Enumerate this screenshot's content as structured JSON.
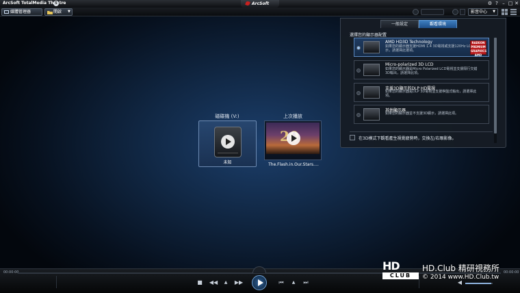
{
  "titlebar": {
    "app_title": "ArcSoft TotalMedia Theatre",
    "badge": "5",
    "brand": "ArcSoft"
  },
  "toolbar": {
    "breadcrumb_home": "媒體管理器",
    "breadcrumb_open": "開啟",
    "media_center": "影音中心"
  },
  "tiles": {
    "disc": {
      "label": "磁碟機 (V:)",
      "caption": "未知"
    },
    "last_played": {
      "label": "上次播放",
      "caption": "The.Flash.in.Our.Stars.…",
      "thumb_text": "20"
    }
  },
  "panel": {
    "tabs": [
      "一般設定",
      "觀看環境"
    ],
    "active_tab": 1,
    "heading": "選擇您的顯示器配置",
    "options": [
      {
        "title": "AMD HD3D Technology",
        "desc": "如果您的顯示器支援HDMI 1.4 3D電視或支援120Hz LCD顯示，請選擇此選項。",
        "selected": true
      },
      {
        "title": "Micro-polarized 3D LCD",
        "desc": "如果您的顯示器是Micro Polarized LCD電視並支援隔行交錯3D輸出，請選擇此項。",
        "selected": false
      },
      {
        "title": "支援3D顯示的DLP HD電視",
        "desc": "如果您的顯示器是DLP 3D電視並支援棋盤式輸出，請選擇此項。",
        "selected": false
      },
      {
        "title": "其他顯示器",
        "desc": "如果您的顯示器並不支援3D顯示，請選擇此項。",
        "selected": false
      }
    ],
    "radeon_text": "RADEON PREMIUM GRAPHICS AMD",
    "swap_label": "在3D模式下觀看產生視覺疲勞時，交換左/右眼影像。"
  },
  "controls": {
    "time_elapsed": "00:00:00",
    "time_total": "00:00:00",
    "volume_level": 0.95
  },
  "watermark": {
    "logo_top": "HD",
    "logo_bottom": "CLUB",
    "line1": "HD.Club 精研視務所",
    "line2": "© 2014  www.HD.Club.tw"
  }
}
